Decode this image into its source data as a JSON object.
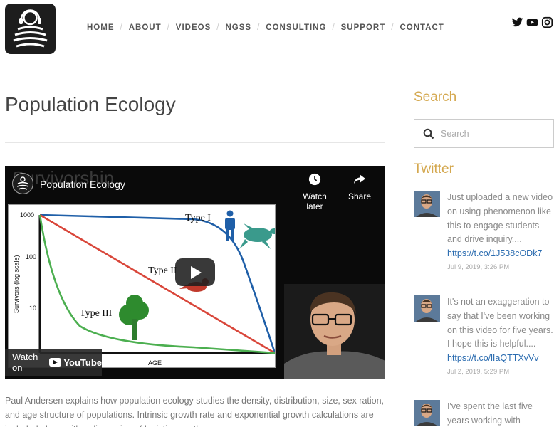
{
  "nav": {
    "items": [
      {
        "label": "HOME"
      },
      {
        "label": "ABOUT"
      },
      {
        "label": "VIDEOS"
      },
      {
        "label": "NGSS"
      },
      {
        "label": "CONSULTING"
      },
      {
        "label": "SUPPORT"
      },
      {
        "label": "CONTACT"
      }
    ],
    "separator": "/"
  },
  "social": [
    "twitter-icon",
    "youtube-icon",
    "instagram-icon"
  ],
  "page": {
    "title": "Population Ecology",
    "description": "Paul Andersen explains how population ecology studies the density, distribution, size, sex ration, and age structure of populations. Intrinsic growth rate and exponential growth calculations are included along with a discussion of logistic growth."
  },
  "video": {
    "background_title": "Survivorship",
    "title": "Population Ecology",
    "watch_later": "Watch later",
    "share": "Share",
    "watch_on": "Watch on",
    "youtube": "YouTube",
    "plot": {
      "y_ticks": [
        "1000",
        "100",
        "10"
      ],
      "ylabel": "Survivors (log scale)",
      "xlabel": "AGE",
      "labels": {
        "type1": "Type I",
        "type2": "Type II",
        "type3": "Type III"
      },
      "colors": {
        "type1": "#1f5fa8",
        "type2": "#d9463a",
        "type3": "#4caf50"
      }
    }
  },
  "sidebar": {
    "search_heading": "Search",
    "search_placeholder": "Search",
    "twitter_heading": "Twitter",
    "tweets": [
      {
        "text": "Just uploaded a new video on using phenomenon like this to engage students and drive inquiry....",
        "link": "https://t.co/1J538cODk7",
        "date": "Jul 9, 2019, 3:26 PM"
      },
      {
        "text": "It's not an exaggeration to say that I've been working on this video for five years. I hope this is helpful....",
        "link": "https://t.co/lIaQTTXvVv",
        "date": "Jul 2, 2019, 5:29 PM"
      },
      {
        "text": "I've spent the last five years working with",
        "link": "",
        "date": ""
      }
    ]
  },
  "colors": {
    "accent": "#d4a84f",
    "link": "#2b6cb0"
  }
}
